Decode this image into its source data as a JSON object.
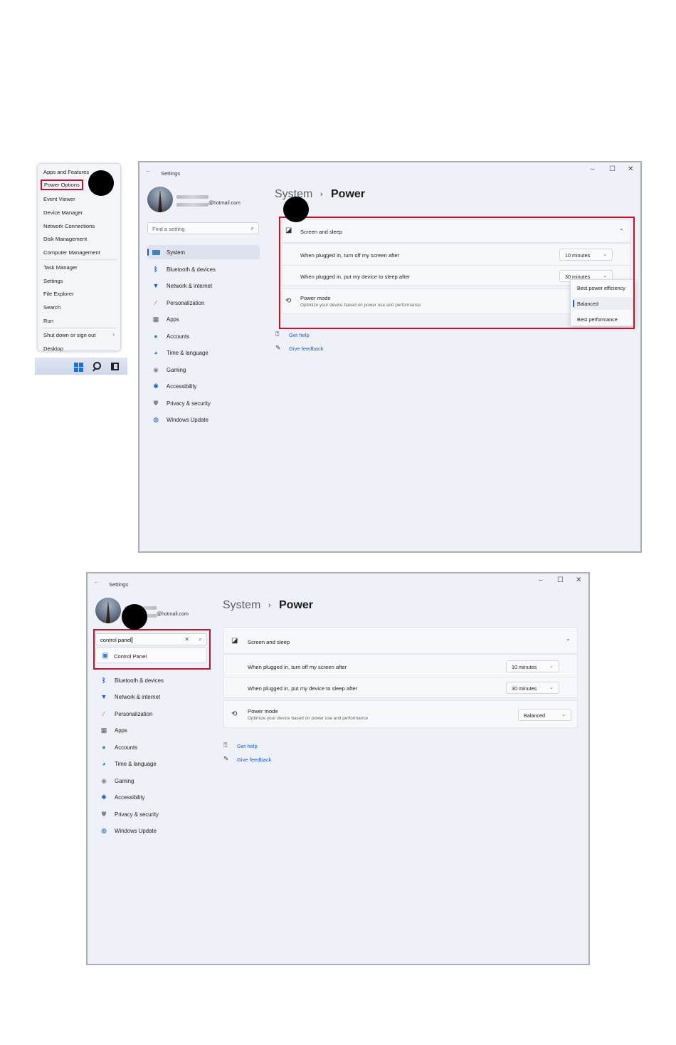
{
  "context_menu": {
    "items": [
      "Apps and Features",
      "Power Options",
      "Event Viewer",
      "Device Manager",
      "Network Connections",
      "Disk Management",
      "Computer Management",
      "Task Manager",
      "Settings",
      "File Explorer",
      "Search",
      "Run",
      "Shut down or sign out",
      "Desktop"
    ],
    "highlighted": "Power Options"
  },
  "settings1": {
    "title": "Settings",
    "email_suffix": "@hotmail.com",
    "search_placeholder": "Find a setting",
    "nav": [
      "System",
      "Bluetooth & devices",
      "Network & internet",
      "Personalization",
      "Apps",
      "Accounts",
      "Time & language",
      "Gaming",
      "Accessibility",
      "Privacy & security",
      "Windows Update"
    ],
    "breadcrumb_parent": "System",
    "breadcrumb_sep": "›",
    "page_title": "Power",
    "screen_sleep": {
      "label": "Screen and sleep",
      "screen_off_label": "When plugged in, turn off my screen after",
      "screen_off_value": "10 minutes",
      "sleep_label": "When plugged in, put my device to sleep after",
      "sleep_value": "30 minutes"
    },
    "power_mode": {
      "label": "Power mode",
      "description": "Optimize your device based on power use and performance",
      "options": [
        "Best power efficiency",
        "Balanced",
        "Best performance"
      ],
      "selected": "Balanced"
    },
    "links": {
      "help": "Get help",
      "feedback": "Give feedback"
    }
  },
  "settings2": {
    "title": "Settings",
    "email_suffix": "@hotmail.com",
    "search_value": "control panel",
    "suggestion": "Control Panel",
    "nav": [
      "Bluetooth & devices",
      "Network & internet",
      "Personalization",
      "Apps",
      "Accounts",
      "Time & language",
      "Gaming",
      "Accessibility",
      "Privacy & security",
      "Windows Update"
    ],
    "breadcrumb_parent": "System",
    "breadcrumb_sep": "›",
    "page_title": "Power",
    "screen_sleep": {
      "label": "Screen and sleep",
      "screen_off_label": "When plugged in, turn off my screen after",
      "screen_off_value": "10 minutes",
      "sleep_label": "When plugged in, put my device to sleep after",
      "sleep_value": "30 minutes"
    },
    "power_mode": {
      "label": "Power mode",
      "description": "Optimize your device based on power use and performance",
      "value": "Balanced"
    },
    "links": {
      "help": "Get help",
      "feedback": "Give feedback"
    }
  },
  "colors": {
    "highlight_red": "#c8102e",
    "accent_blue": "#1a5fc2",
    "window_bg": "#eef1f8"
  },
  "icons": {
    "minimize": "–",
    "maximize": "☐",
    "close": "✕",
    "chevron_up": "⌃",
    "chevron_down": "⌄",
    "back": "←",
    "search": "⌕",
    "clear": "✕"
  }
}
